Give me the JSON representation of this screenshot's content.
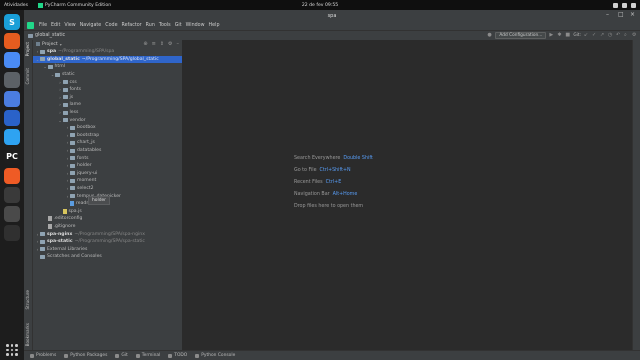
{
  "topbar": {
    "activities": "Atividades",
    "app": "PyCharm Community Edition",
    "clock": "22 de fev  09:55"
  },
  "dock": {
    "apps": [
      {
        "name": "skype",
        "glyph": "S",
        "color": "#1a9fd8"
      },
      {
        "name": "firefox",
        "glyph": "",
        "color": "#e65c1f"
      },
      {
        "name": "chrome",
        "glyph": "",
        "color": "#4a8bf4"
      },
      {
        "name": "files",
        "glyph": "",
        "color": "#5c6166"
      },
      {
        "name": "editor",
        "glyph": "",
        "color": "#4b7de0"
      },
      {
        "name": "notes",
        "glyph": "",
        "color": "#2a62c9"
      },
      {
        "name": "vscode",
        "glyph": "",
        "color": "#2ea3f2"
      },
      {
        "name": "pycharm",
        "glyph": "PC",
        "color": "#1e1e1e"
      },
      {
        "name": "postman",
        "glyph": "",
        "color": "#ef5b25"
      },
      {
        "name": "terminal",
        "glyph": "",
        "color": "#3a3a3a"
      },
      {
        "name": "kdenlive",
        "glyph": "",
        "color": "#4a4a4a"
      },
      {
        "name": "obs",
        "glyph": "",
        "color": "#303030"
      }
    ]
  },
  "window": {
    "title": "spa"
  },
  "menu": [
    "File",
    "Edit",
    "View",
    "Navigate",
    "Code",
    "Refactor",
    "Run",
    "Tools",
    "Git",
    "Window",
    "Help"
  ],
  "navbar": {
    "crumb": "global_static",
    "add_config": "Add Configuration...",
    "git_label": "Git:"
  },
  "project_panel": {
    "title": "Project"
  },
  "tree": [
    {
      "indent": 0,
      "arrow": "›",
      "kind": "fold",
      "label": "spa",
      "path": "~/Programming/SPA/spa",
      "bold": true
    },
    {
      "indent": 0,
      "arrow": "⌄",
      "kind": "fold",
      "label": "global_static",
      "path": "~/Programming/SPA/global_static",
      "bold": true,
      "selected": true
    },
    {
      "indent": 1,
      "arrow": "⌄",
      "kind": "fold",
      "label": "html"
    },
    {
      "indent": 2,
      "arrow": "⌄",
      "kind": "fold",
      "label": "static"
    },
    {
      "indent": 3,
      "arrow": "›",
      "kind": "fold",
      "label": "css"
    },
    {
      "indent": 3,
      "arrow": "›",
      "kind": "fold",
      "label": "fonts"
    },
    {
      "indent": 3,
      "arrow": "›",
      "kind": "fold",
      "label": "js"
    },
    {
      "indent": 3,
      "arrow": "›",
      "kind": "fold",
      "label": "lame"
    },
    {
      "indent": 3,
      "arrow": "›",
      "kind": "fold",
      "label": "less"
    },
    {
      "indent": 3,
      "arrow": "⌄",
      "kind": "fold",
      "label": "vendor"
    },
    {
      "indent": 4,
      "arrow": "›",
      "kind": "fold",
      "label": "bootbox"
    },
    {
      "indent": 4,
      "arrow": "›",
      "kind": "fold",
      "label": "bootstrap"
    },
    {
      "indent": 4,
      "arrow": "›",
      "kind": "fold",
      "label": "chart_js"
    },
    {
      "indent": 4,
      "arrow": "›",
      "kind": "fold",
      "label": "datatables"
    },
    {
      "indent": 4,
      "arrow": "›",
      "kind": "fold",
      "label": "fonts"
    },
    {
      "indent": 4,
      "arrow": "›",
      "kind": "fold",
      "label": "holder"
    },
    {
      "indent": 4,
      "arrow": "›",
      "kind": "fold",
      "label": "jquery-ui"
    },
    {
      "indent": 4,
      "arrow": "›",
      "kind": "fold",
      "label": "moment"
    },
    {
      "indent": 4,
      "arrow": "›",
      "kind": "fold",
      "label": "select2"
    },
    {
      "indent": 4,
      "arrow": "›",
      "kind": "fold",
      "label": "tempus_datepicker"
    },
    {
      "indent": 4,
      "arrow": "",
      "kind": "file md",
      "label": "readme.md"
    },
    {
      "indent": 3,
      "arrow": "",
      "kind": "file js",
      "label": "spa.js"
    },
    {
      "indent": 1,
      "arrow": "",
      "kind": "file cfg",
      "label": ".editorconfig"
    },
    {
      "indent": 1,
      "arrow": "",
      "kind": "file cfg",
      "label": ".gitignore"
    },
    {
      "indent": 0,
      "arrow": "›",
      "kind": "fold",
      "label": "spa-nginx",
      "path": "~/Programming/SPA/spa-nginx",
      "bold": true
    },
    {
      "indent": 0,
      "arrow": "›",
      "kind": "fold",
      "label": "spa-static",
      "path": "~/Programming/SPA/spa-static",
      "bold": true
    },
    {
      "indent": 0,
      "arrow": "›",
      "kind": "fold",
      "label": "External Libraries"
    },
    {
      "indent": 0,
      "arrow": "",
      "kind": "fold",
      "label": "Scratches and Consoles"
    }
  ],
  "tooltip": "holder",
  "hints": [
    {
      "text": "Search Everywhere",
      "key": "Double Shift"
    },
    {
      "text": "Go to File",
      "key": "Ctrl+Shift+N"
    },
    {
      "text": "Recent Files",
      "key": "Ctrl+E"
    },
    {
      "text": "Navigation Bar",
      "key": "Alt+Home"
    },
    {
      "text": "Drop files here to open them",
      "key": ""
    }
  ],
  "left_tabs": [
    "Project",
    "Commit",
    "Structure",
    "Bookmarks"
  ],
  "statusbar": [
    "Problems",
    "Python Packages",
    "Git",
    "Terminal",
    "TODO",
    "Python Console"
  ]
}
